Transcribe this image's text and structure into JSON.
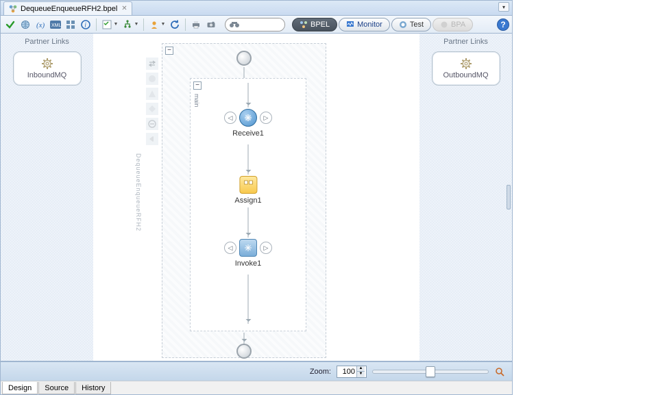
{
  "tab": {
    "title": "DequeueEnqueueRFH2.bpel"
  },
  "toolbar": {
    "search_placeholder": "",
    "search_value": "",
    "pills": {
      "bpel": "BPEL",
      "monitor": "Monitor",
      "test": "Test",
      "bpa": "BPA"
    }
  },
  "left_panel": {
    "title": "Partner Links",
    "items": [
      {
        "name": "InboundMQ"
      }
    ]
  },
  "right_panel": {
    "title": "Partner Links",
    "items": [
      {
        "name": "OutboundMQ"
      }
    ]
  },
  "flow": {
    "scope_label": "DequeueEnqueueRFH2",
    "main_label": "main",
    "activities": [
      {
        "label": "Receive1"
      },
      {
        "label": "Assign1"
      },
      {
        "label": "Invoke1"
      }
    ]
  },
  "status": {
    "zoom_label": "Zoom:",
    "zoom_value": "100"
  },
  "bottom_tabs": [
    "Design",
    "Source",
    "History"
  ]
}
